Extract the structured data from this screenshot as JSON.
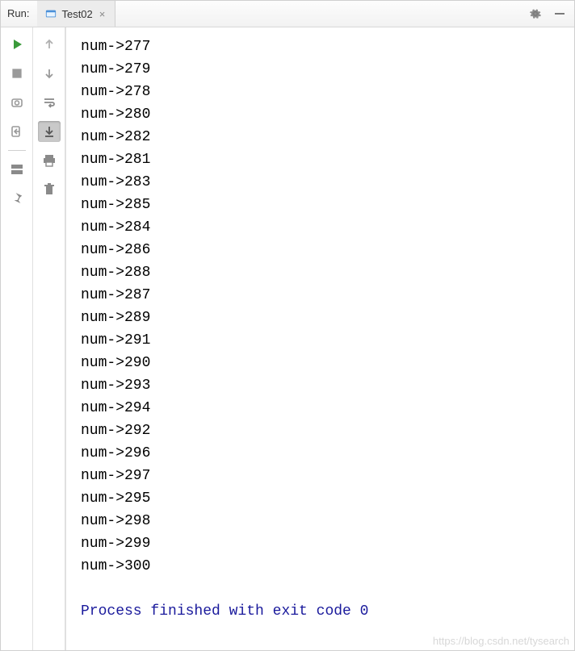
{
  "topbar": {
    "run_label": "Run:",
    "tab_label": "Test02",
    "tab_close": "×"
  },
  "console": {
    "prefix": "num->",
    "values": [
      277,
      279,
      278,
      280,
      282,
      281,
      283,
      285,
      284,
      286,
      288,
      287,
      289,
      291,
      290,
      293,
      294,
      292,
      296,
      297,
      295,
      298,
      299,
      300
    ],
    "exit_message": "Process finished with exit code 0"
  },
  "watermark": "https://blog.csdn.net/tysearch"
}
